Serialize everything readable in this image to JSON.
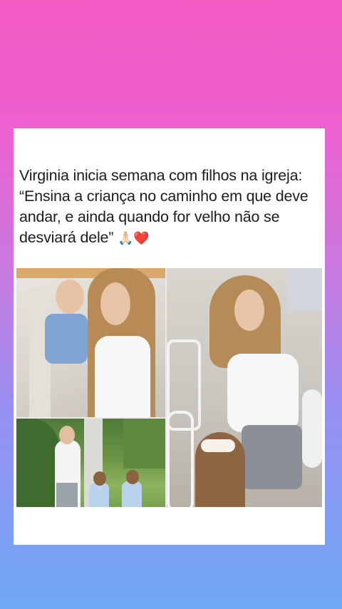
{
  "post": {
    "caption": "Virginia inicia semana com filhos na igreja: “Ensina a criança no caminho em que deve andar, e ainda quando for velho não se desviará dele”",
    "caption_emojis": "🙏🏻❤️"
  },
  "photos": [
    {
      "name": "photo-mother-with-baby"
    },
    {
      "name": "photo-mother-kneeling-with-daughter"
    },
    {
      "name": "photo-family-outdoors"
    }
  ]
}
